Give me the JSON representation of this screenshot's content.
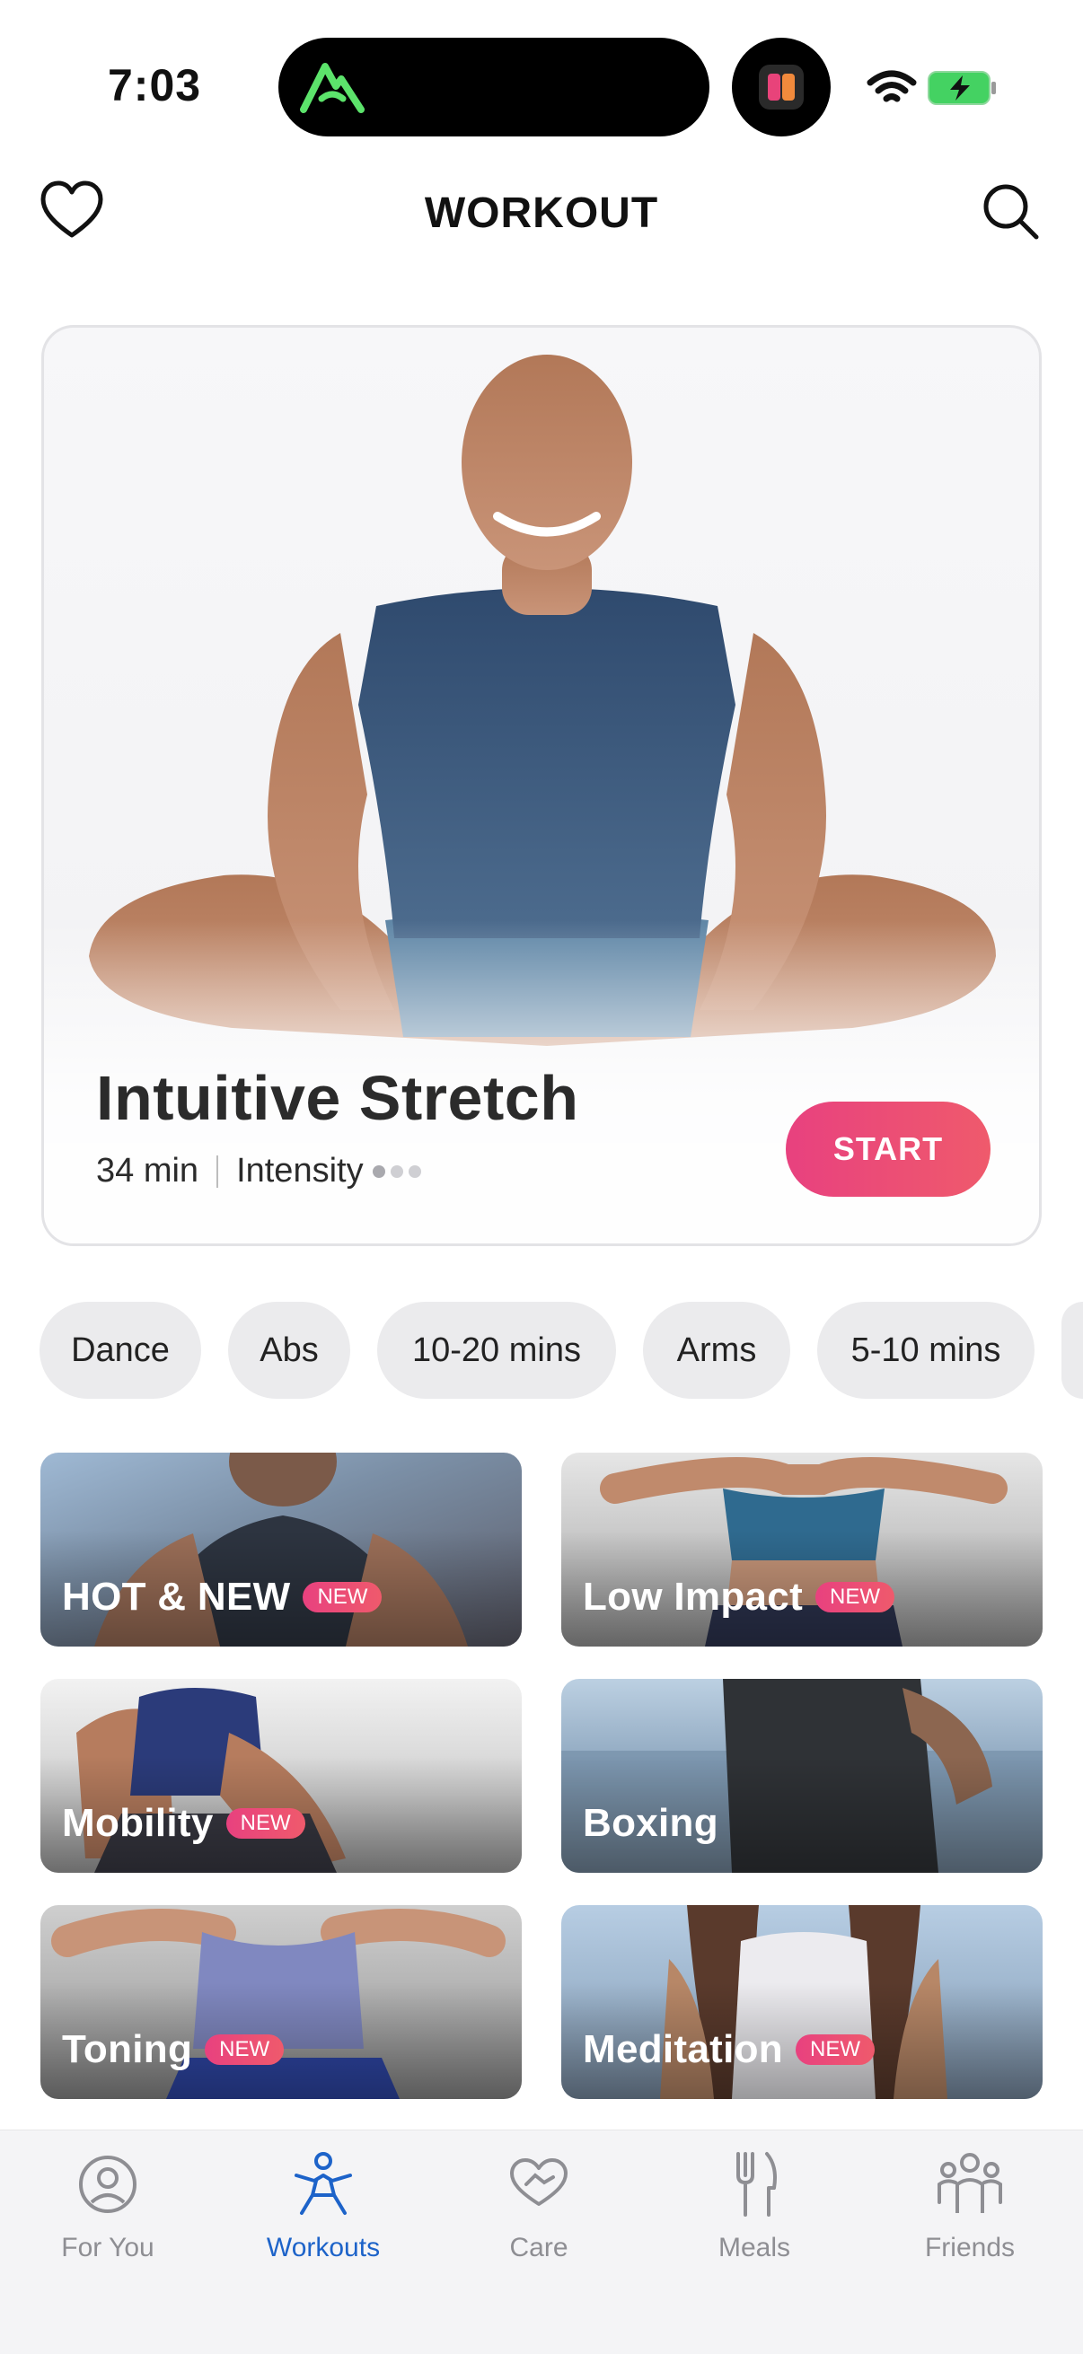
{
  "status_bar": {
    "time": "7:03",
    "icons": [
      "alltrails-icon",
      "app-icon",
      "wifi-icon",
      "battery-charging-icon"
    ]
  },
  "header": {
    "title": "WORKOUT",
    "left_icon": "heart-icon",
    "right_icon": "search-icon"
  },
  "hero": {
    "title": "Intuitive Stretch",
    "duration": "34 min",
    "intensity_label": "Intensity",
    "intensity_level": 1,
    "intensity_max": 3,
    "start_label": "START"
  },
  "chips": [
    "Dance",
    "Abs",
    "10-20 mins",
    "Arms",
    "5-10 mins"
  ],
  "categories": [
    {
      "name": "HOT & NEW",
      "badge": "NEW"
    },
    {
      "name": "Low Impact",
      "badge": "NEW"
    },
    {
      "name": "Mobility",
      "badge": "NEW"
    },
    {
      "name": "Boxing",
      "badge": ""
    },
    {
      "name": "Toning",
      "badge": "NEW"
    },
    {
      "name": "Meditation",
      "badge": "NEW"
    }
  ],
  "tabs": [
    {
      "label": "For You",
      "icon": "user-circle-icon",
      "active": false
    },
    {
      "label": "Workouts",
      "icon": "workout-figure-icon",
      "active": true
    },
    {
      "label": "Care",
      "icon": "care-hands-icon",
      "active": false
    },
    {
      "label": "Meals",
      "icon": "fork-knife-icon",
      "active": false
    },
    {
      "label": "Friends",
      "icon": "friends-icon",
      "active": false
    }
  ],
  "colors": {
    "accent_pink": "#e8417f",
    "active_tab": "#1d63c9",
    "inactive_tab": "#8e8e93",
    "chip_bg": "#ebebed"
  }
}
